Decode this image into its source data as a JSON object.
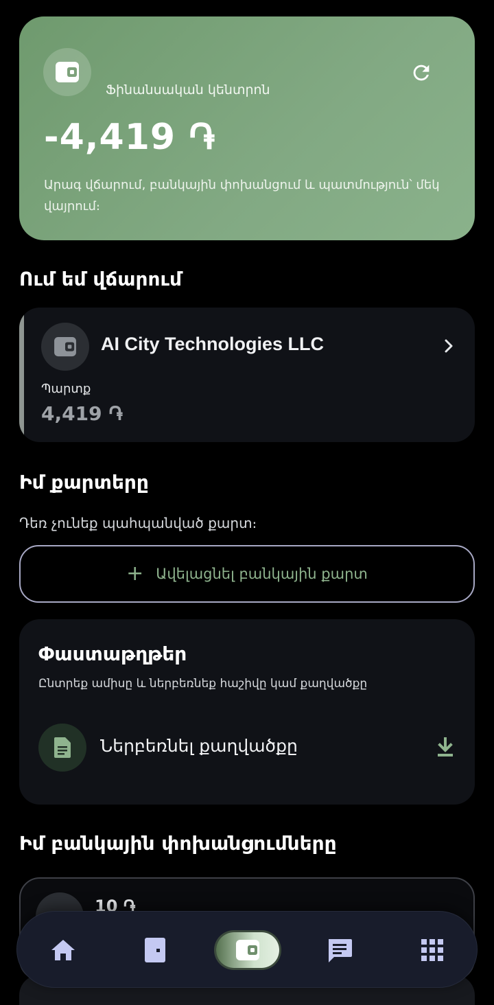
{
  "hero": {
    "title": "Ֆինանսական կենտրոն",
    "amount": "-4,419 ֏",
    "description": "Արագ վճարում, բանկային փոխանցում և պատմություն՝ մեկ վայրում։"
  },
  "payees": {
    "title": "Ում եմ վճարում",
    "items": [
      {
        "name": "AI City Technologies LLC",
        "debt_label": "Պարտք",
        "debt": "4,419 ֏"
      }
    ]
  },
  "cards": {
    "title": "Իմ քարտերը",
    "empty_text": "Դեռ չունեք պահպանված քարտ։",
    "add_button_plus": "+",
    "add_button_label": "Ավելացնել բանկային քարտ"
  },
  "documents": {
    "title": "Փաստաթղթեր",
    "subtitle": "Ընտրեք ամիսը և ներբեռնեք հաշիվը կամ քաղվածքը",
    "action_label": "Ներբեռնել քաղվածքը"
  },
  "transfers": {
    "title": "Իմ բանկային փոխանցումները",
    "items": [
      {
        "amount": "10 ֏"
      }
    ]
  },
  "nav": {
    "items": [
      {
        "icon": "home-icon",
        "active": false
      },
      {
        "icon": "card-icon",
        "active": false
      },
      {
        "icon": "wallet-icon",
        "active": true
      },
      {
        "icon": "chat-icon",
        "active": false
      },
      {
        "icon": "apps-grid-icon",
        "active": false
      }
    ]
  },
  "colors": {
    "accent_green": "#8fb48e",
    "hero_gradient_start": "#6f9a6e",
    "hero_gradient_end": "#8ab28b",
    "nav_background": "#181c2b"
  }
}
